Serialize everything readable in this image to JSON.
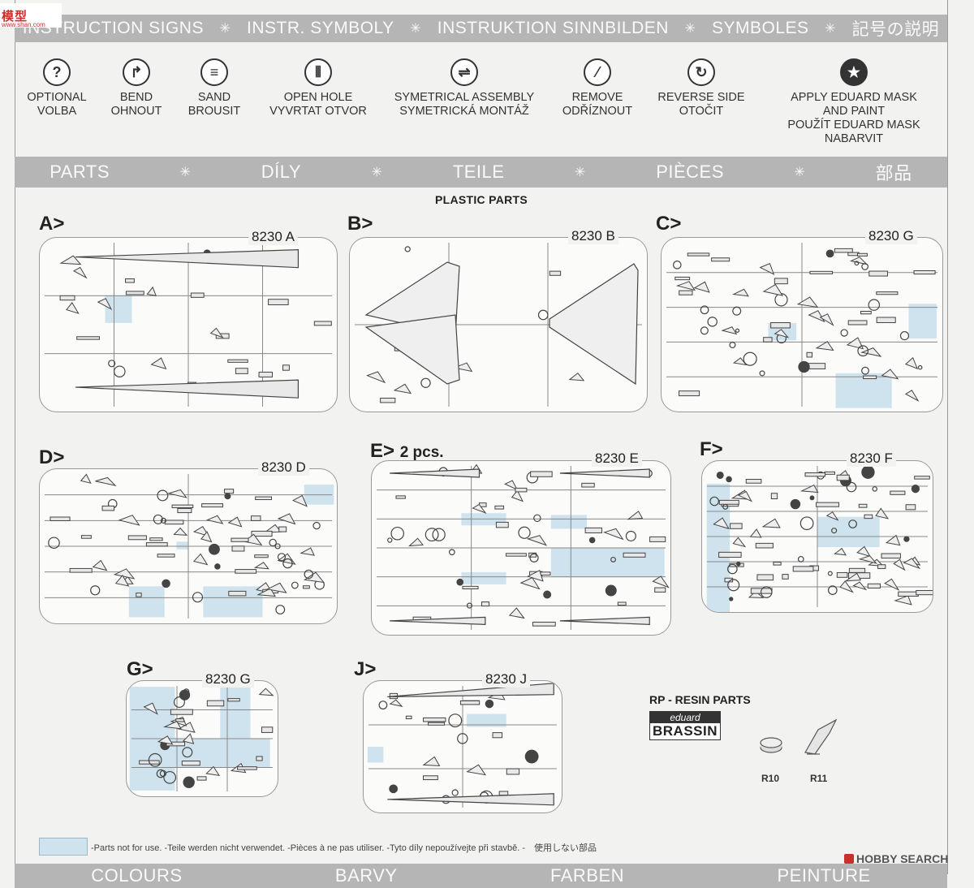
{
  "header_logo": {
    "brand": "模型",
    "url": "www.shan.com"
  },
  "instruction_signs_band": {
    "titles": [
      "INSTRUCTION SIGNS",
      "INSTR. SYMBOLY",
      "INSTRUKTION SINNBILDEN",
      "SYMBOLES",
      "記号の説明"
    ],
    "separator": "✳"
  },
  "symbols": [
    {
      "icon": "question-mark-icon",
      "glyph": "?",
      "lines": [
        "OPTIONAL",
        "VOLBA"
      ]
    },
    {
      "icon": "bend-arrow-icon",
      "glyph": "↱",
      "lines": [
        "BEND",
        "OHNOUT"
      ]
    },
    {
      "icon": "sand-file-icon",
      "glyph": "≡",
      "lines": [
        "SAND",
        "BROUSIT"
      ]
    },
    {
      "icon": "drill-hole-icon",
      "glyph": "⦀",
      "lines": [
        "OPEN HOLE",
        "VYVRTAT OTVOR"
      ]
    },
    {
      "icon": "symmetric-assembly-icon",
      "glyph": "⇌",
      "lines": [
        "SYMETRICAL ASSEMBLY",
        "SYMETRICKÁ MONTÁŽ"
      ]
    },
    {
      "icon": "remove-knife-icon",
      "glyph": "⁄",
      "lines": [
        "REMOVE",
        "ODŘÍZNOUT"
      ]
    },
    {
      "icon": "reverse-side-icon",
      "glyph": "↻",
      "lines": [
        "REVERSE SIDE",
        "OTOČIT"
      ]
    },
    {
      "icon": "star-mask-icon",
      "glyph": "★",
      "lines": [
        "APPLY EDUARD MASK",
        "AND PAINT",
        "POUŽÍT EDUARD MASK",
        "NABARVIT"
      ]
    }
  ],
  "parts_band": {
    "titles": [
      "PARTS",
      "DÍLY",
      "TEILE",
      "PIÈCES",
      "部品"
    ],
    "separator": "✳"
  },
  "plastic_parts_title": "PLASTIC PARTS",
  "sprues": [
    {
      "letter": "A>",
      "code": "8230 A",
      "pcs": ""
    },
    {
      "letter": "B>",
      "code": "8230 B",
      "pcs": ""
    },
    {
      "letter": "C>",
      "code": "8230 G",
      "pcs": ""
    },
    {
      "letter": "D>",
      "code": "8230 D",
      "pcs": ""
    },
    {
      "letter": "E>",
      "code": "8230 E",
      "pcs": "2 pcs."
    },
    {
      "letter": "F>",
      "code": "8230 F",
      "pcs": ""
    },
    {
      "letter": "G>",
      "code": "8230 G",
      "pcs": ""
    },
    {
      "letter": "J>",
      "code": "8230 J",
      "pcs": ""
    }
  ],
  "resin": {
    "title": "RP - RESIN PARTS",
    "brand_top": "eduard",
    "brand_bottom": "BRASSIN",
    "parts": [
      "R10",
      "R11"
    ]
  },
  "legend_text": "-Parts not for use. -Teile werden nicht verwendet. -Pièces à ne pas utiliser. -Tyto díly nepoužívejte při stavbě. -　使用しない部品",
  "colours_band": {
    "titles": [
      "COLOURS",
      "BARVY",
      "FARBEN",
      "PEINTURE"
    ]
  },
  "watermark": "HOBBY SEARCH",
  "colors": {
    "band": "#b5b5b5",
    "unused_highlight": "#cfe3ee",
    "line": "#555555"
  }
}
